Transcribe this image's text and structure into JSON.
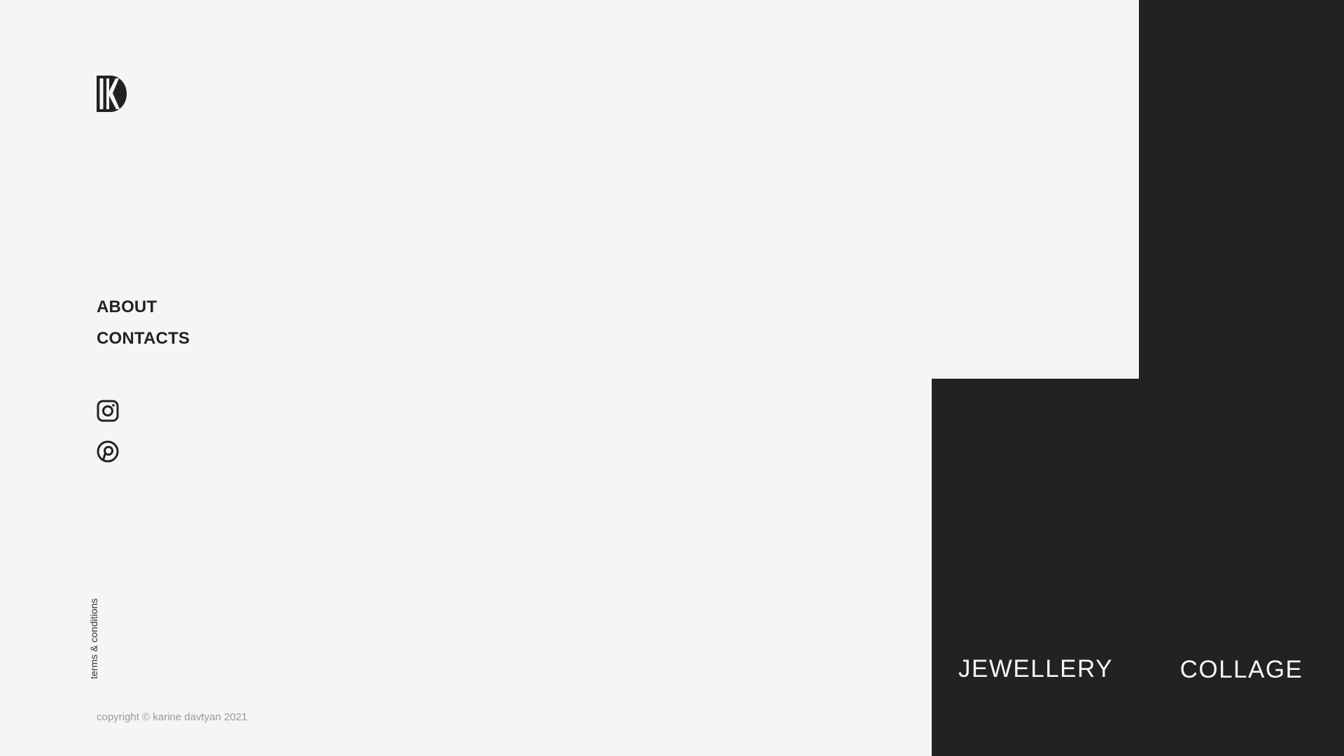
{
  "brand": {
    "logo_icon": "kd-monogram-icon"
  },
  "nav": {
    "items": [
      {
        "label": "ABOUT"
      },
      {
        "label": "CONTACTS"
      }
    ]
  },
  "social": {
    "items": [
      {
        "icon": "instagram-icon"
      },
      {
        "icon": "pinterest-icon"
      }
    ]
  },
  "footer": {
    "terms_label": "terms & conditions",
    "copyright": "copyright © karine davtyan 2021"
  },
  "categories": [
    {
      "label": "JEWELLERY"
    },
    {
      "label": "COLLAGE"
    }
  ],
  "colors": {
    "background": "#f5f5f5",
    "panel": "#222222",
    "text": "#222222",
    "muted": "#9a9a9a"
  }
}
